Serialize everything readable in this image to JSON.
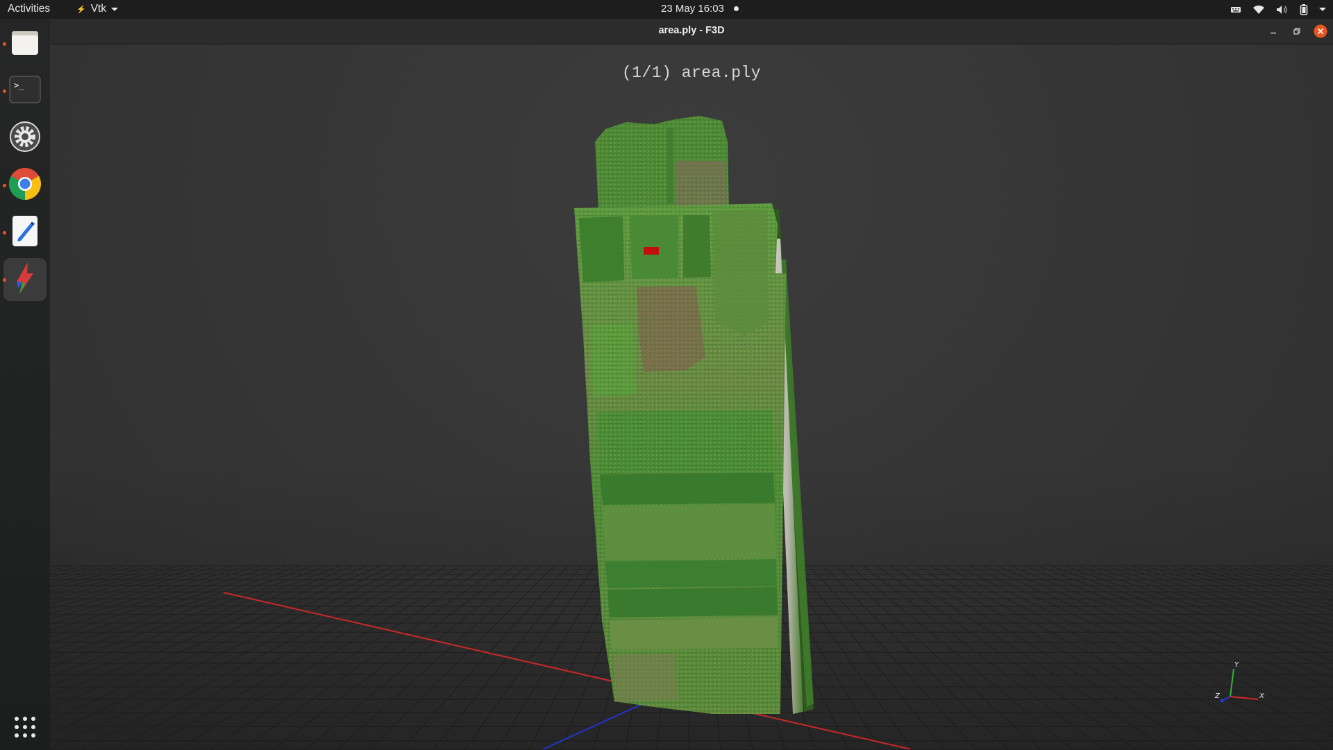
{
  "topbar": {
    "activities": "Activities",
    "app_menu": "Vtk",
    "clock": "23 May  16:03"
  },
  "dock": {
    "items": [
      {
        "name": "files",
        "icon": "folder-icon",
        "running": true
      },
      {
        "name": "terminal",
        "icon": "terminal-icon",
        "running": true
      },
      {
        "name": "settings",
        "icon": "gear-icon",
        "running": false
      },
      {
        "name": "chrome",
        "icon": "chrome-icon",
        "running": true
      },
      {
        "name": "text-editor",
        "icon": "text-editor-icon",
        "running": true
      },
      {
        "name": "f3d",
        "icon": "f3d-icon",
        "running": true,
        "active": true
      }
    ],
    "show_apps_icon": "app-grid-icon"
  },
  "window": {
    "title": "area.ply - F3D",
    "file_header": "(1/1) area.ply",
    "axes_widget": {
      "x_label": "X",
      "y_label": "Y",
      "z_label": "Z"
    }
  },
  "colors": {
    "accent": "#e95420",
    "axis_x": "#d42a2a",
    "axis_y": "#2fb53c",
    "axis_z": "#2a3bd4",
    "viewport_bg": "#373737"
  }
}
